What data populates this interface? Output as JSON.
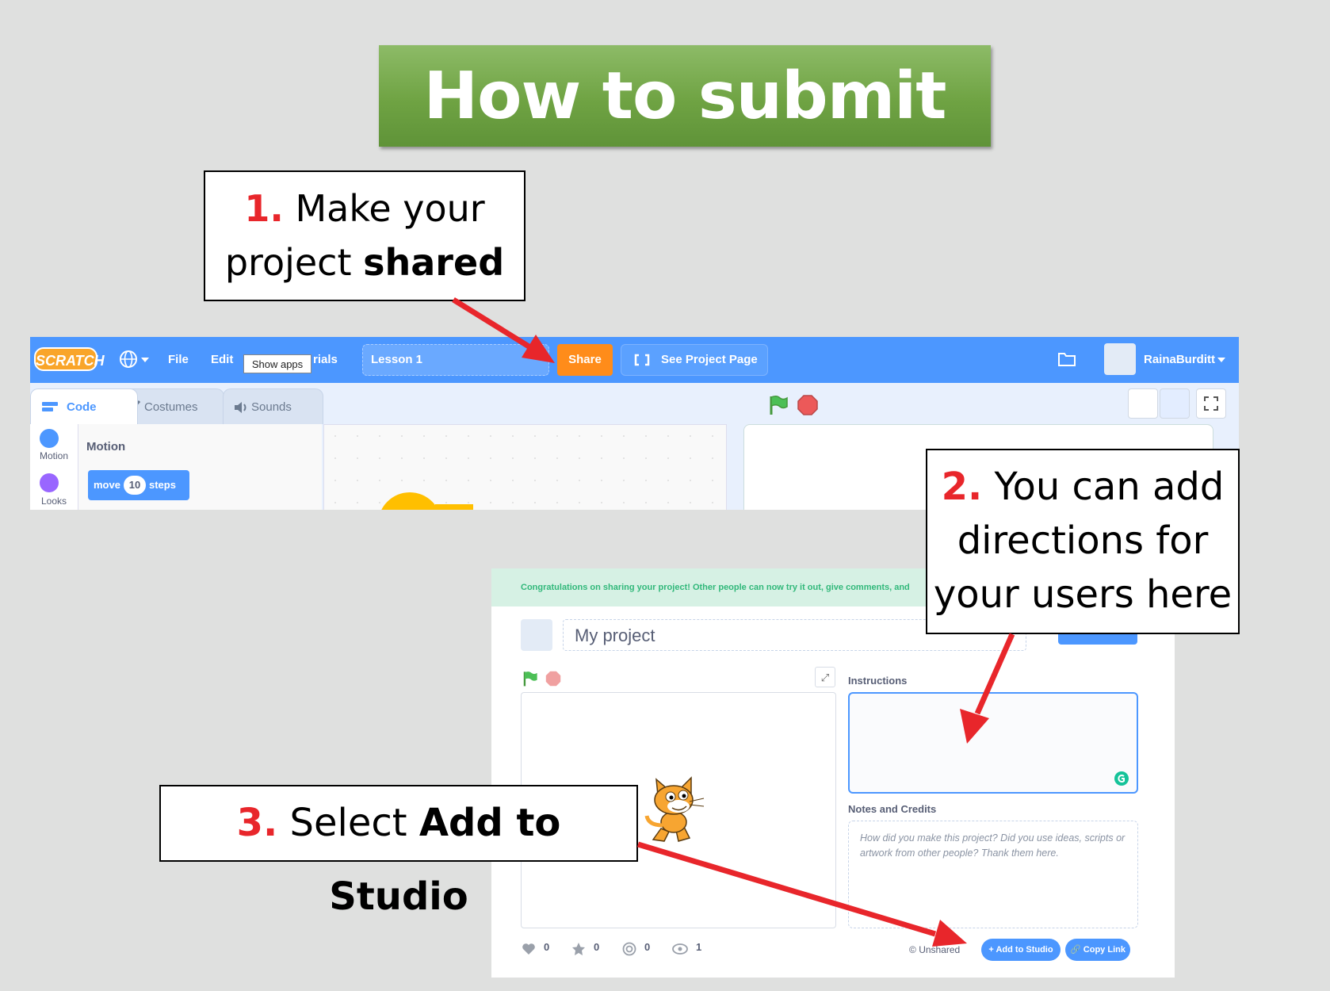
{
  "title": "How to submit",
  "callouts": {
    "step1": {
      "number": "1.",
      "line1": "Make your",
      "line2_pre": "project ",
      "line2_bold": "shared"
    },
    "step2": {
      "number": "2.",
      "line1": "You can add",
      "line2": "directions for",
      "line3": "your users here"
    },
    "step3": {
      "number": "3.",
      "text_pre": "Select ",
      "text_bold": "Add to Studio"
    }
  },
  "editor": {
    "logo": "SCRATCH",
    "menu": {
      "file": "File",
      "edit": "Edit",
      "tutorials_partial": "rials",
      "tooltip": "Show apps"
    },
    "project_title": "Lesson 1",
    "share_label": "Share",
    "see_project_page_label": "See Project Page",
    "username": "RainaBurditt",
    "tabs": {
      "code": "Code",
      "costumes": "Costumes",
      "sounds": "Sounds"
    },
    "categories": [
      {
        "label": "Motion",
        "color": "#4c97ff"
      },
      {
        "label": "Looks",
        "color": "#9966ff"
      }
    ],
    "palette_heading": "Motion",
    "move_block": {
      "pre": "move",
      "value": "10",
      "post": "steps"
    }
  },
  "project_page": {
    "congrats": "Congratulations on sharing your project! Other people can now try it out, give comments, and",
    "project_name": "My project",
    "instructions_label": "Instructions",
    "notes_label": "Notes and Credits",
    "notes_placeholder": "How did you make this project? Did you use ideas, scripts or artwork from other people? Thank them here.",
    "stats": {
      "loves": "0",
      "favorites": "0",
      "remixes": "0",
      "views": "1"
    },
    "unshared": "Unshared",
    "add_to_studio": "Add to Studio",
    "copy_link": "Copy Link"
  },
  "colors": {
    "accent": "#4c97ff",
    "share": "#ff8c1a",
    "arrow": "#e8262b",
    "banner": "#6fa343"
  }
}
